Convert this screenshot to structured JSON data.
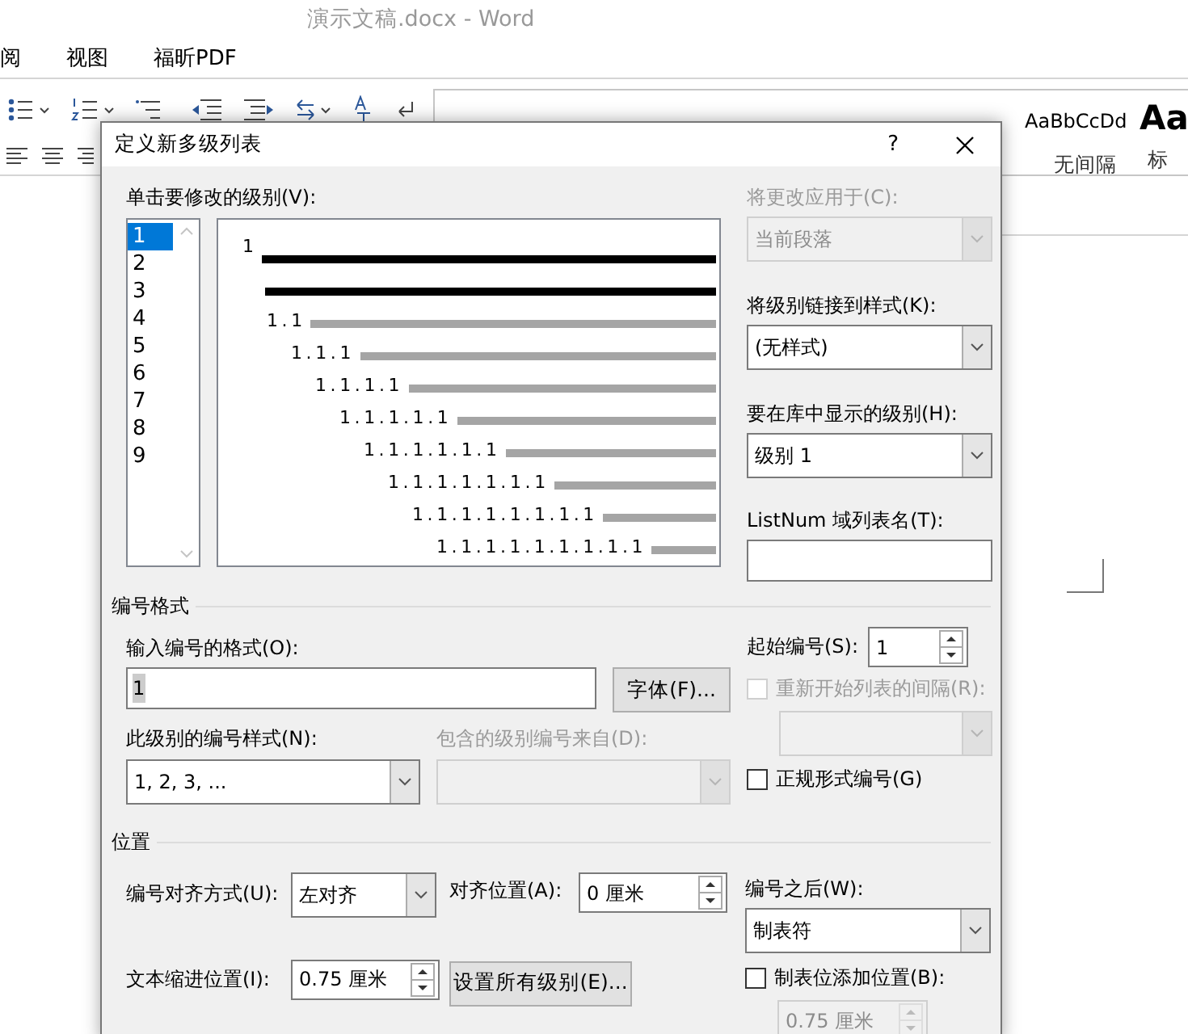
{
  "window": {
    "title": "演示文稿.docx - Word"
  },
  "menu_tabs": [
    "阅",
    "视图",
    "福昕PDF"
  ],
  "style_gallery": [
    {
      "sample": "AaBbCcDd",
      "caption": "无间隔",
      "kind": "normal"
    },
    {
      "sample": "Aa",
      "caption": "标",
      "kind": "heading"
    }
  ],
  "dialog": {
    "title": "定义新多级列表",
    "help": "?",
    "levels": {
      "label": "单击要修改的级别(V):",
      "items": [
        {
          "text": "1",
          "selected": true
        },
        {
          "text": "2",
          "selected": false
        },
        {
          "text": "3",
          "selected": false
        },
        {
          "text": "4",
          "selected": false
        },
        {
          "text": "5",
          "selected": false
        },
        {
          "text": "6",
          "selected": false
        },
        {
          "text": "7",
          "selected": false
        },
        {
          "text": "8",
          "selected": false
        },
        {
          "text": "9",
          "selected": false
        }
      ]
    },
    "preview": [
      {
        "kind": "heading",
        "number": "1"
      },
      {
        "kind": "continuation"
      },
      {
        "kind": "sub",
        "number": "1.1"
      },
      {
        "kind": "sub",
        "number": "1.1.1"
      },
      {
        "kind": "sub",
        "number": "1.1.1.1"
      },
      {
        "kind": "sub",
        "number": "1.1.1.1.1"
      },
      {
        "kind": "sub",
        "number": "1.1.1.1.1.1"
      },
      {
        "kind": "sub",
        "number": "1.1.1.1.1.1.1"
      },
      {
        "kind": "sub",
        "number": "1.1.1.1.1.1.1.1"
      },
      {
        "kind": "sub",
        "number": "1.1.1.1.1.1.1.1.1"
      }
    ],
    "apply_to": {
      "label": "将更改应用于(C):",
      "value": "当前段落",
      "disabled": true
    },
    "link_style": {
      "label": "将级别链接到样式(K):",
      "value": "(无样式)",
      "disabled": false
    },
    "gallery_level": {
      "label": "要在库中显示的级别(H):",
      "value": "级别 1",
      "disabled": false
    },
    "listnum": {
      "label": "ListNum 域列表名(T):"
    },
    "number_format": {
      "title": "编号格式",
      "format_input": {
        "label": "输入编号的格式(O):",
        "value": "1"
      },
      "font_button": "字体(F)...",
      "number_style": {
        "label": "此级别的编号样式(N):",
        "value": "1, 2, 3, ...",
        "disabled": false
      },
      "include_from": {
        "label": "包含的级别编号来自(D):",
        "disabled": true
      },
      "start_at": {
        "label": "起始编号(S):",
        "value": "1",
        "disabled": false
      },
      "restart": {
        "label": "重新开始列表的间隔(R):",
        "checked": false,
        "disabled": true
      },
      "restart_after": {
        "disabled": true
      },
      "legal": {
        "label": "正规形式编号(G)",
        "checked": false,
        "disabled": false
      }
    },
    "position": {
      "title": "位置",
      "alignment": {
        "label": "编号对齐方式(U):",
        "value": "左对齐",
        "disabled": false
      },
      "align_at": {
        "label": "对齐位置(A):",
        "value": "0 厘米",
        "disabled": false
      },
      "indent": {
        "label": "文本缩进位置(I):",
        "value": "0.75 厘米",
        "disabled": false
      },
      "set_all_button": "设置所有级别(E)...",
      "follow": {
        "label": "编号之后(W):",
        "value": "制表符",
        "disabled": false
      },
      "tab_stop": {
        "label": "制表位添加位置(B):",
        "checked": false,
        "disabled": false
      },
      "tab_stop_value": {
        "value": "0.75 厘米",
        "disabled": true
      }
    }
  }
}
